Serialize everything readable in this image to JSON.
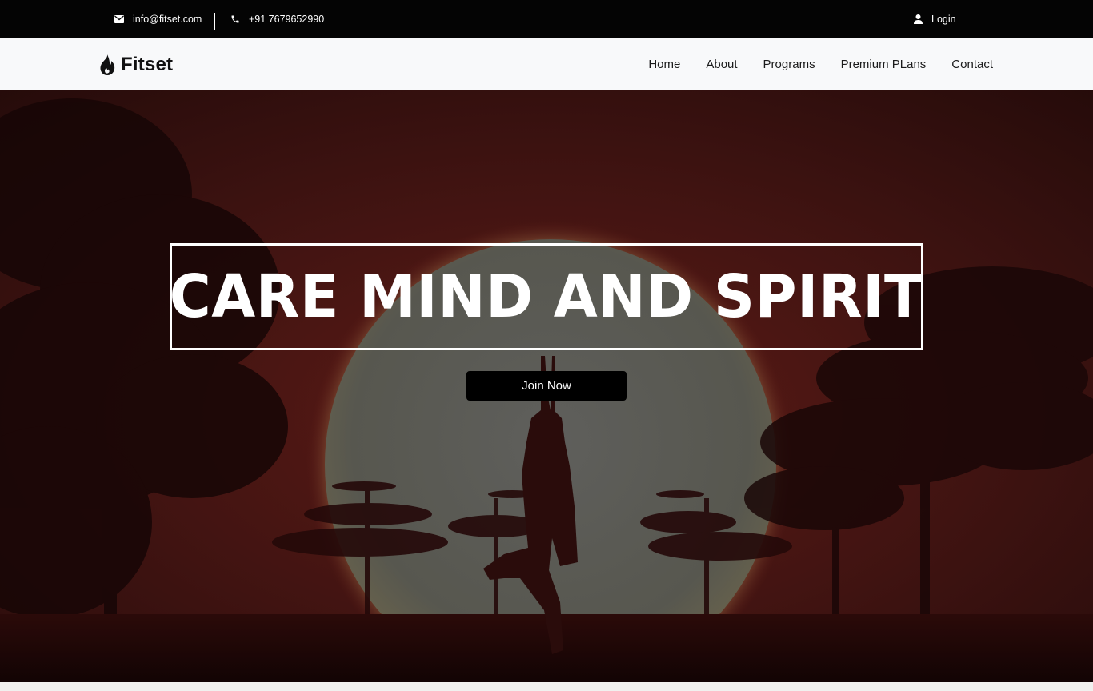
{
  "topbar": {
    "email": "info@fitset.com",
    "phone": "+91 7679652990",
    "login": "Login",
    "icons": {
      "email": "envelope-icon",
      "phone": "phone-icon",
      "login": "user-icon"
    }
  },
  "navbar": {
    "brand": "Fitset",
    "brand_icon": "flame-icon",
    "links": [
      "Home",
      "About",
      "Programs",
      "Premium PLans",
      "Contact"
    ]
  },
  "hero": {
    "title": "CARE MIND AND SPIRIT",
    "cta": "Join Now",
    "background": "sunset yoga silhouette"
  },
  "colors": {
    "topbar_bg": "#040404",
    "navbar_bg": "#f8f9fa",
    "hero_tint": "#3a1110",
    "button_bg": "#000000",
    "text_light": "#ffffff"
  }
}
